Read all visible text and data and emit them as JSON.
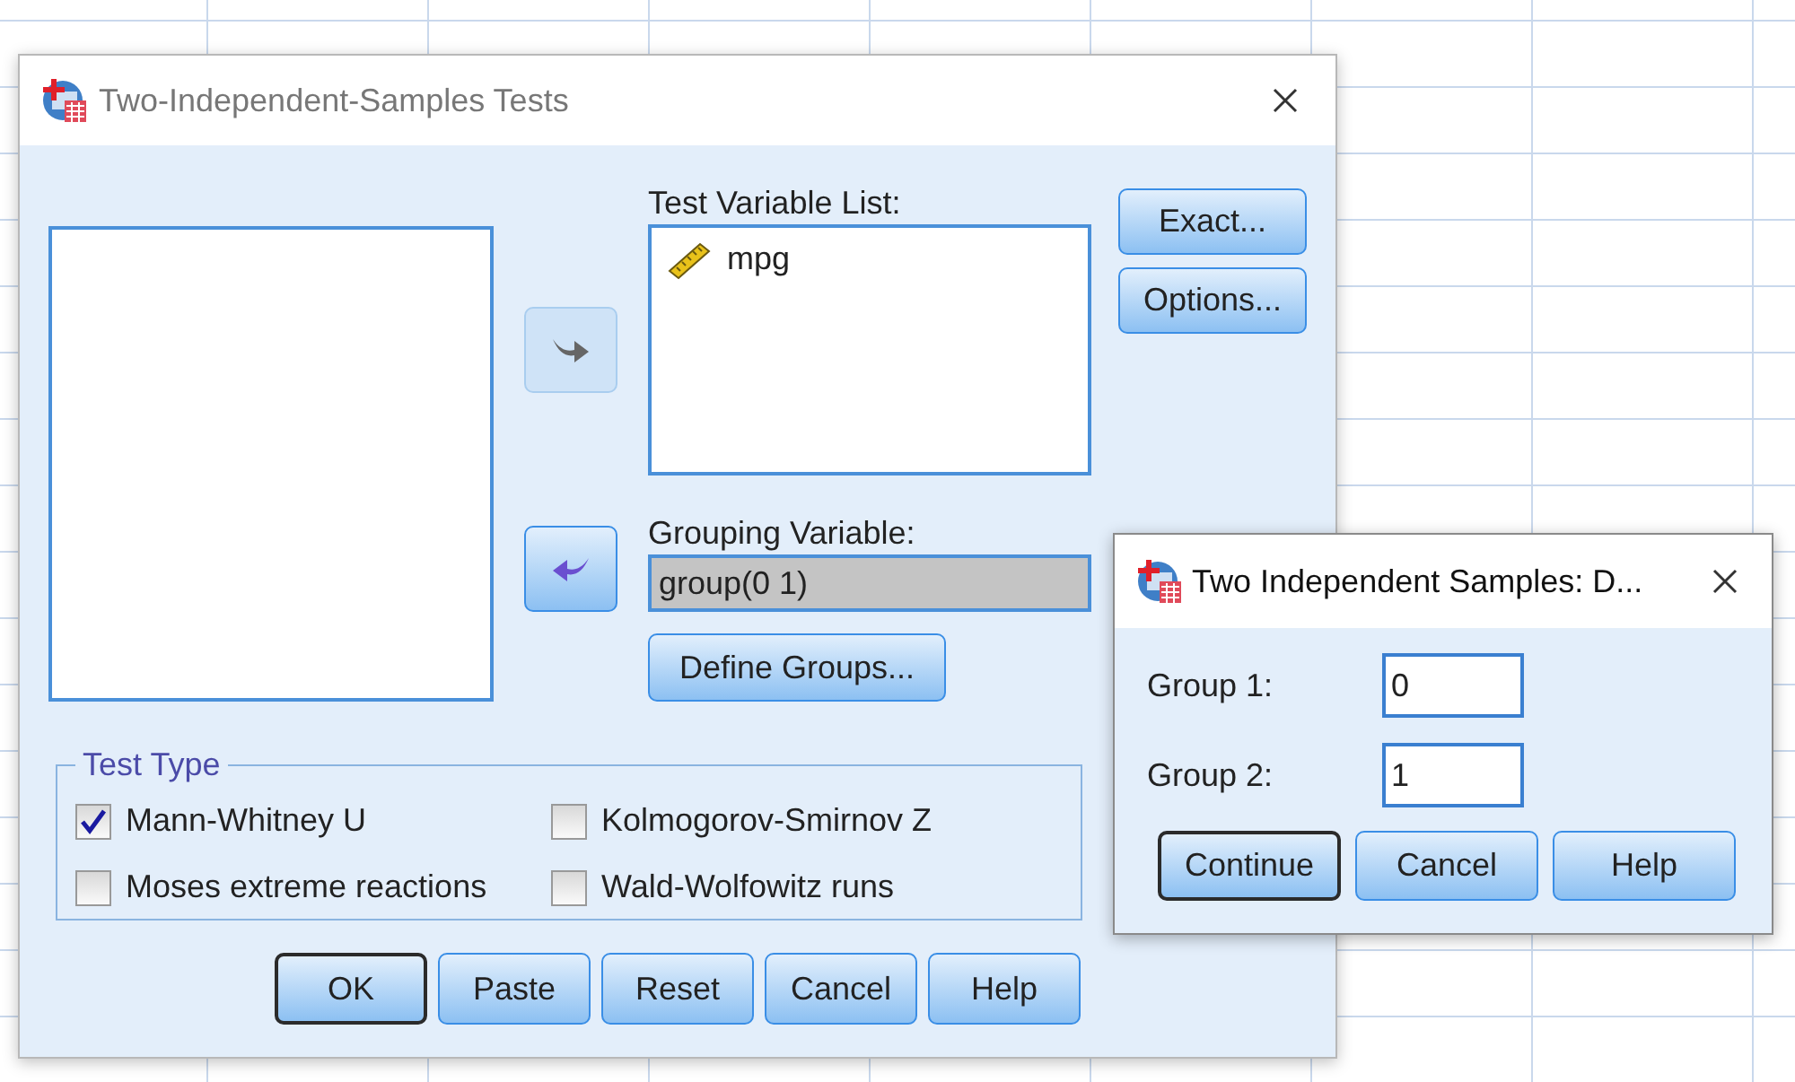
{
  "main_dialog": {
    "title": "Two-Independent-Samples Tests",
    "move_buttons": [
      {
        "kind": "move-right",
        "disabled": true
      },
      {
        "kind": "move-left",
        "disabled": false
      }
    ],
    "test_variable_list": {
      "label": "Test Variable List:",
      "items": [
        {
          "name": "mpg",
          "kind": "scale"
        }
      ]
    },
    "grouping_variable": {
      "label": "Grouping Variable:",
      "value": "group(0 1)"
    },
    "define_groups_button": {
      "label": "Define Groups..."
    },
    "side_buttons": [
      {
        "label": "Exact..."
      },
      {
        "label": "Options..."
      }
    ],
    "test_type": {
      "title": "Test Type",
      "options": [
        {
          "label": "Mann-Whitney U",
          "checked": true
        },
        {
          "label": "Kolmogorov-Smirnov Z",
          "checked": false
        },
        {
          "label": "Moses extreme reactions",
          "checked": false
        },
        {
          "label": "Wald-Wolfowitz runs",
          "checked": false
        }
      ]
    },
    "buttons": [
      {
        "label": "OK",
        "default": true
      },
      {
        "label": "Paste",
        "default": false
      },
      {
        "label": "Reset",
        "default": false
      },
      {
        "label": "Cancel",
        "default": false
      },
      {
        "label": "Help",
        "default": false
      }
    ]
  },
  "define_groups_dialog": {
    "title": "Two Independent Samples: D...",
    "fields": [
      {
        "label": "Group 1:",
        "value": "0"
      },
      {
        "label": "Group 2:",
        "value": "1"
      }
    ],
    "buttons": [
      {
        "label": "Continue",
        "default": true
      },
      {
        "label": "Cancel",
        "default": false
      },
      {
        "label": "Help",
        "default": false
      }
    ]
  }
}
